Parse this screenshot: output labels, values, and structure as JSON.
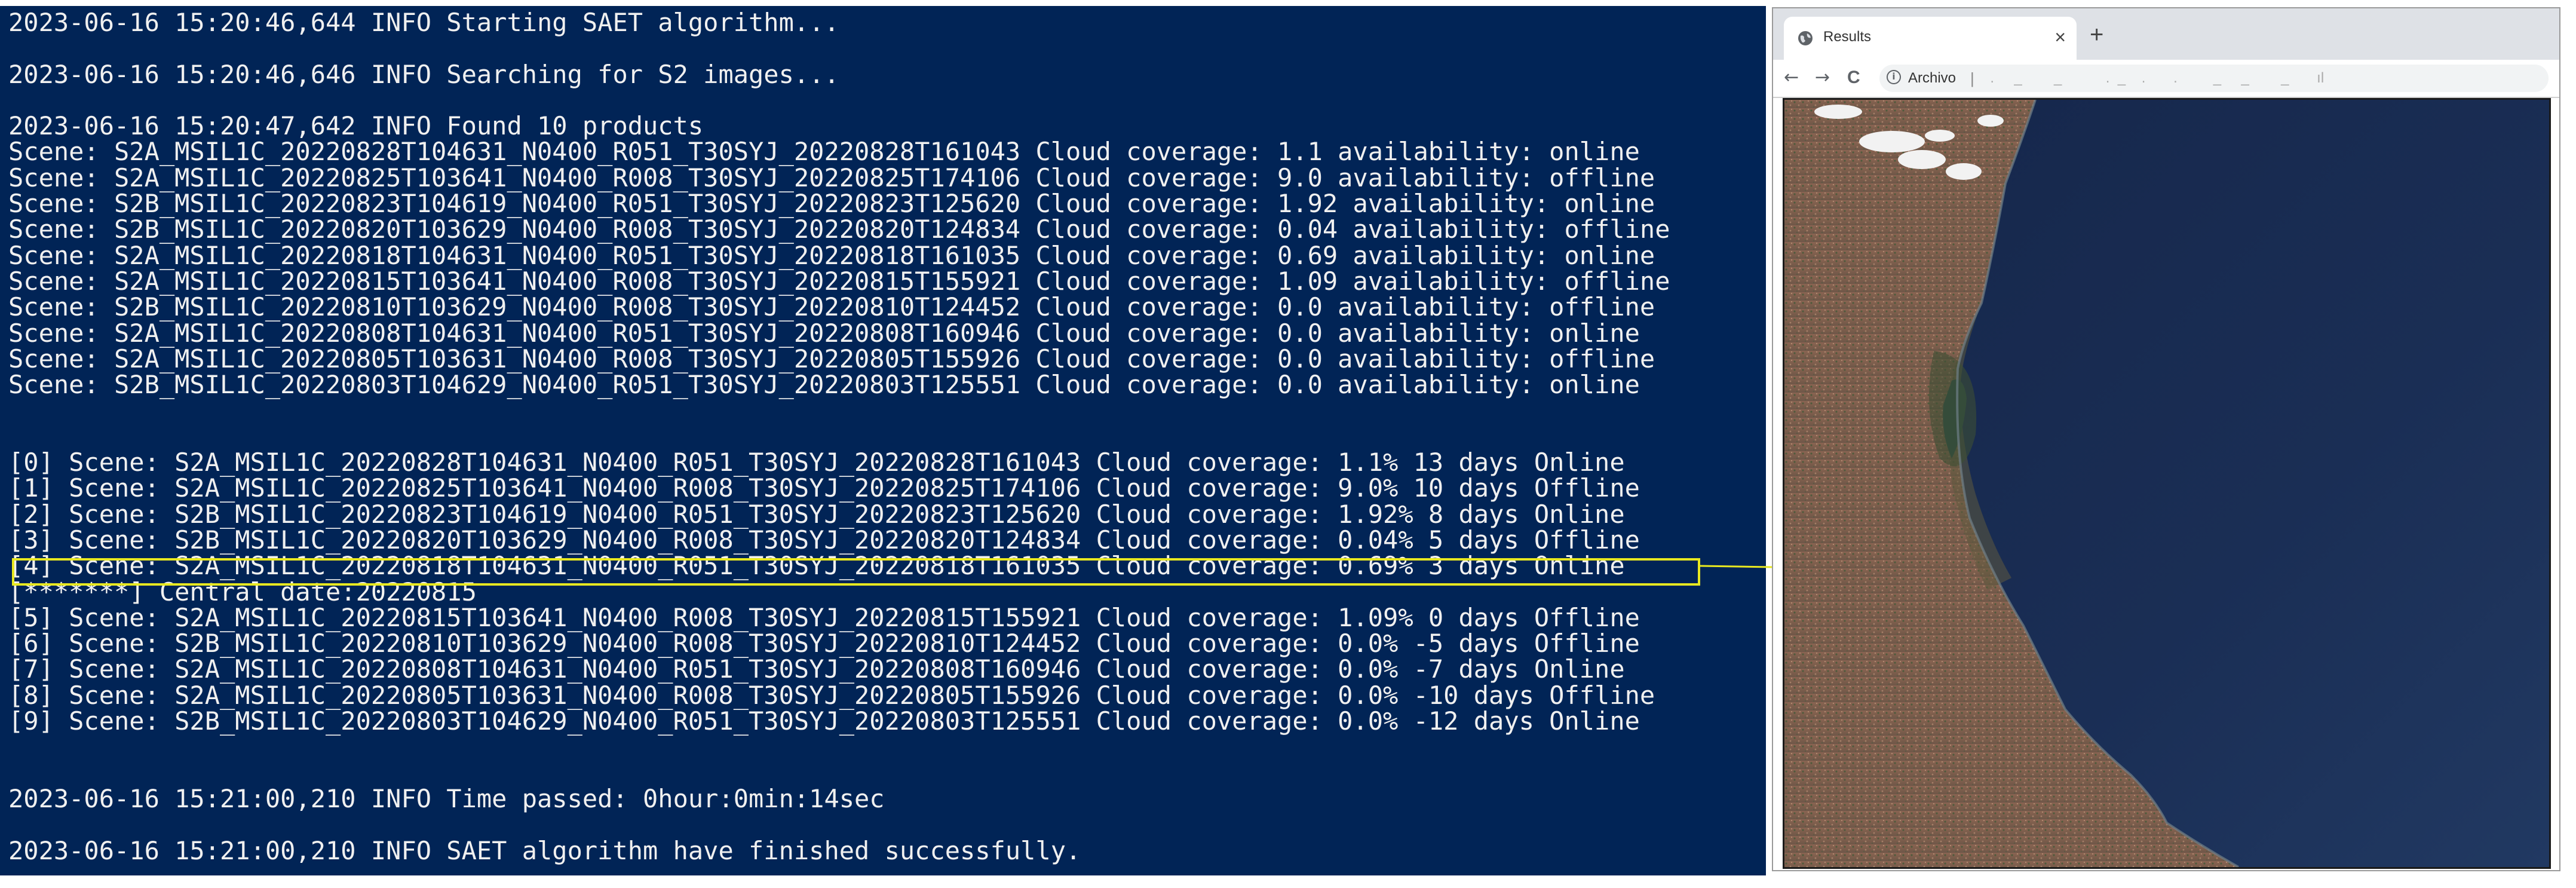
{
  "terminal": {
    "lines": [
      "2023-06-16 15:20:46,644 INFO Starting SAET algorithm...",
      "",
      "2023-06-16 15:20:46,646 INFO Searching for S2 images...",
      "",
      "2023-06-16 15:20:47,642 INFO Found 10 products",
      "Scene: S2A_MSIL1C_20220828T104631_N0400_R051_T30SYJ_20220828T161043 Cloud coverage: 1.1 availability: online",
      "Scene: S2A_MSIL1C_20220825T103641_N0400_R008_T30SYJ_20220825T174106 Cloud coverage: 9.0 availability: offline",
      "Scene: S2B_MSIL1C_20220823T104619_N0400_R051_T30SYJ_20220823T125620 Cloud coverage: 1.92 availability: online",
      "Scene: S2B_MSIL1C_20220820T103629_N0400_R008_T30SYJ_20220820T124834 Cloud coverage: 0.04 availability: offline",
      "Scene: S2A_MSIL1C_20220818T104631_N0400_R051_T30SYJ_20220818T161035 Cloud coverage: 0.69 availability: online",
      "Scene: S2A_MSIL1C_20220815T103641_N0400_R008_T30SYJ_20220815T155921 Cloud coverage: 1.09 availability: offline",
      "Scene: S2B_MSIL1C_20220810T103629_N0400_R008_T30SYJ_20220810T124452 Cloud coverage: 0.0 availability: offline",
      "Scene: S2A_MSIL1C_20220808T104631_N0400_R051_T30SYJ_20220808T160946 Cloud coverage: 0.0 availability: online",
      "Scene: S2A_MSIL1C_20220805T103631_N0400_R008_T30SYJ_20220805T155926 Cloud coverage: 0.0 availability: offline",
      "Scene: S2B_MSIL1C_20220803T104629_N0400_R051_T30SYJ_20220803T125551 Cloud coverage: 0.0 availability: online",
      "",
      "",
      "[0] Scene: S2A_MSIL1C_20220828T104631_N0400_R051_T30SYJ_20220828T161043 Cloud coverage: 1.1% 13 days Online",
      "[1] Scene: S2A_MSIL1C_20220825T103641_N0400_R008_T30SYJ_20220825T174106 Cloud coverage: 9.0% 10 days Offline",
      "[2] Scene: S2B_MSIL1C_20220823T104619_N0400_R051_T30SYJ_20220823T125620 Cloud coverage: 1.92% 8 days Online",
      "[3] Scene: S2B_MSIL1C_20220820T103629_N0400_R008_T30SYJ_20220820T124834 Cloud coverage: 0.04% 5 days Offline",
      "[4] Scene: S2A_MSIL1C_20220818T104631_N0400_R051_T30SYJ_20220818T161035 Cloud coverage: 0.69% 3 days Online",
      "[*******] Central date:20220815",
      "[5] Scene: S2A_MSIL1C_20220815T103641_N0400_R008_T30SYJ_20220815T155921 Cloud coverage: 1.09% 0 days Offline",
      "[6] Scene: S2B_MSIL1C_20220810T103629_N0400_R008_T30SYJ_20220810T124452 Cloud coverage: 0.0% -5 days Offline",
      "[7] Scene: S2A_MSIL1C_20220808T104631_N0400_R051_T30SYJ_20220808T160946 Cloud coverage: 0.0% -7 days Online",
      "[8] Scene: S2A_MSIL1C_20220805T103631_N0400_R008_T30SYJ_20220805T155926 Cloud coverage: 0.0% -10 days Offline",
      "[9] Scene: S2B_MSIL1C_20220803T104629_N0400_R051_T30SYJ_20220803T125551 Cloud coverage: 0.0% -12 days Online",
      "",
      "",
      "2023-06-16 15:21:00,210 INFO Time passed: 0hour:0min:14sec",
      "",
      "2023-06-16 15:21:00,210 INFO SAET algorithm have finished successfully."
    ],
    "highlighted_line": 21,
    "background_color": "#012456",
    "text_color": "#f0f0f0",
    "highlight_color": "#e8e820"
  },
  "browser": {
    "tab": {
      "title": "Results",
      "close_glyph": "×",
      "favicon": "globe-icon"
    },
    "new_tab_glyph": "+",
    "toolbar": {
      "back_glyph": "←",
      "forward_glyph": "→",
      "reload_glyph": "C",
      "info_glyph": "i",
      "scheme_label": "Archivo",
      "separator": "|",
      "url_text": "  .     _        _           .  _    .       .         _     _        _       ıl"
    }
  }
}
